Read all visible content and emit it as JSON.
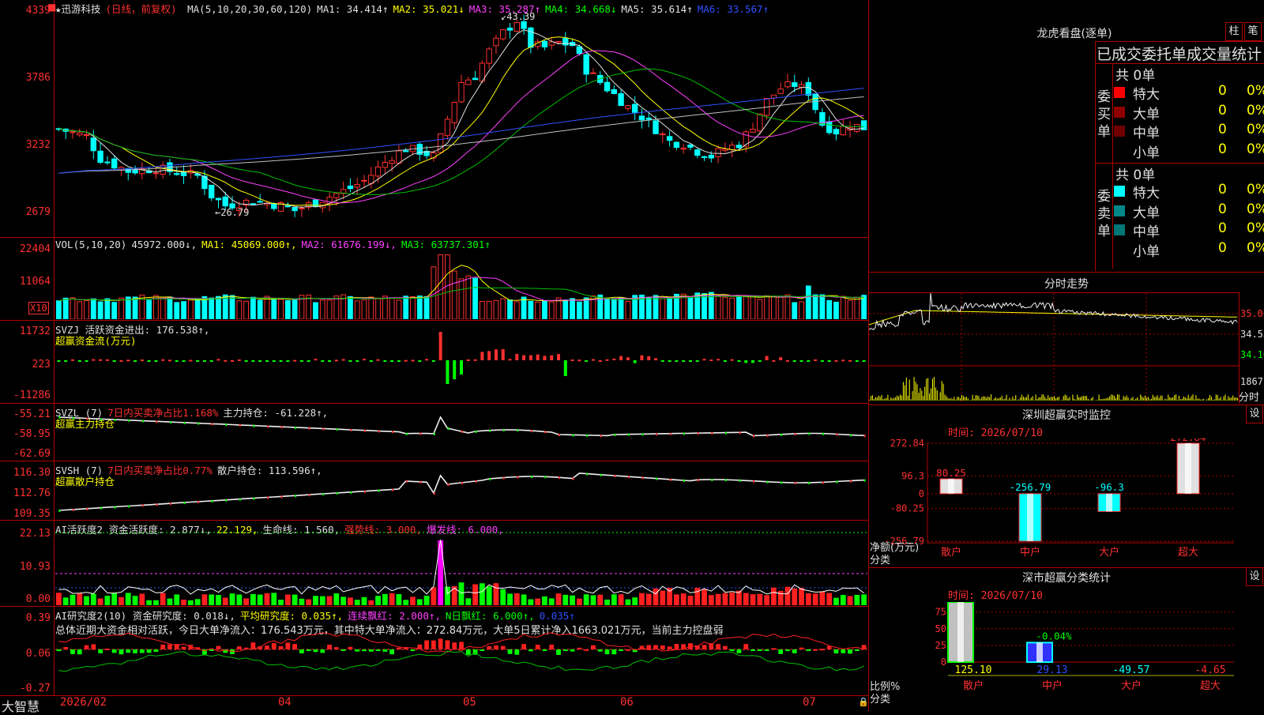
{
  "stock": {
    "name": "★迅游科技",
    "mode": "(日线，前复权)"
  },
  "main_ma": [
    {
      "label": "MA(5,10,20,30,60,120)",
      "cls": "w"
    },
    {
      "label": "MA1: 34.414↑",
      "cls": "w"
    },
    {
      "label": "MA2: 35.021↓",
      "cls": "y"
    },
    {
      "label": "MA3: 35.287↑",
      "cls": "m"
    },
    {
      "label": "MA4: 34.668↓",
      "cls": "g"
    },
    {
      "label": "MA5: 35.614↑",
      "cls": "w"
    },
    {
      "label": "MA6: 33.567↑",
      "cls": "b"
    }
  ],
  "price_axis": [
    "4339",
    "3786",
    "3232",
    "2679"
  ],
  "price_high": "43.39",
  "price_low": "26.79",
  "vol": {
    "axis": [
      "22404",
      "11064",
      "X10"
    ],
    "legend": [
      {
        "label": "VOL(5,10,20)",
        "cls": "w"
      },
      {
        "label": "45972.000↓,",
        "cls": "w"
      },
      {
        "label": "MA1: 45069.000↑,",
        "cls": "y"
      },
      {
        "label": "MA2: 61676.199↓,",
        "cls": "m"
      },
      {
        "label": "MA3: 63737.301↑",
        "cls": "g"
      }
    ]
  },
  "svzj": {
    "axis": [
      "11732",
      "223",
      "-11286"
    ],
    "line1": "SVZJ  活跃资金进出: 176.538↑,",
    "line2": "超赢资金流(万元)"
  },
  "svzl": {
    "axis": [
      "-55.21",
      "-58.95",
      "-62.69"
    ],
    "line1a": "SVZL (7)",
    "line1b": "7日内买卖净占比1.168%",
    "line1c": "主力持仓: -61.228↑,",
    "line2": "超赢主力持仓"
  },
  "svsh": {
    "axis": [
      "116.30",
      "112.76",
      "109.35"
    ],
    "line1a": "SVSH (7)",
    "line1b": "7日内买卖净占比0.77%",
    "line1c": "散户持仓: 113.596↑,",
    "line2": "超赢散户持仓"
  },
  "ai1": {
    "axis": [
      "22.13",
      "10.93",
      "0.00"
    ],
    "legend": [
      {
        "label": "AI活跃度2 资金活跃度: 2.877↓,",
        "cls": "w"
      },
      {
        "label": "22.129,",
        "cls": "y"
      },
      {
        "label": "生命线: 1.560,",
        "cls": "w"
      },
      {
        "label": "强势线: 3.000,",
        "cls": "r"
      },
      {
        "label": "爆发线: 6.000,",
        "cls": "m"
      }
    ]
  },
  "ai2": {
    "axis": [
      "0.39",
      "0.06",
      "-0.27"
    ],
    "legend": [
      {
        "label": "AI研究度2(10) 资金研究度: 0.018↓,",
        "cls": "w"
      },
      {
        "label": "平均研究度: 0.035↑,",
        "cls": "y"
      },
      {
        "label": "连续飘红: 2.000↑,",
        "cls": "m"
      },
      {
        "label": "N日飘红: 6.000↑,",
        "cls": "g"
      },
      {
        "label": "0.035↑",
        "cls": "b"
      }
    ],
    "summary": "总体近期大资金相对活跃，今日大单净流入：176.543万元，其中特大单净流入：272.84万元，大单5日累计净入1663.021万元，当前主力控盘弱"
  },
  "xaxis": {
    "brand": "大智慧",
    "labels": [
      "2026/02",
      "04",
      "05",
      "06",
      "07"
    ]
  },
  "right": {
    "lhkp_title": "龙虎看盘(逐单)",
    "tab_zhu": "柱",
    "tab_bi": "笔",
    "stats_title": "已成交委托单成交量统计",
    "buy": {
      "side": "委买单",
      "total": "共 0单",
      "rows": [
        {
          "name": "特大",
          "v": "0",
          "p": "0%",
          "color": "#ff0000"
        },
        {
          "name": "大单",
          "v": "0",
          "p": "0%",
          "color": "#900000"
        },
        {
          "name": "中单",
          "v": "0",
          "p": "0%",
          "color": "#700000"
        },
        {
          "name": "小单",
          "v": "0",
          "p": "0%",
          "color": ""
        }
      ]
    },
    "sell": {
      "side": "委卖单",
      "total": "共 0单",
      "rows": [
        {
          "name": "特大",
          "v": "0",
          "p": "0%",
          "color": "#00ffff"
        },
        {
          "name": "大单",
          "v": "0",
          "p": "0%",
          "color": "#008888"
        },
        {
          "name": "中单",
          "v": "0",
          "p": "0%",
          "color": "#007777"
        },
        {
          "name": "小单",
          "v": "0",
          "p": "0%",
          "color": ""
        }
      ]
    },
    "fenshi": {
      "title": "分时走势",
      "axis": [
        "35.00",
        "34.55",
        "34.10"
      ],
      "vol_label": "1867",
      "xlabel": "分时"
    },
    "monitor": {
      "title": "深圳超赢实时监控",
      "set": "设",
      "time": "时间: 2026/07/10",
      "axis": [
        "272.84",
        "96.3",
        "0",
        "-80.25",
        "-256.79"
      ],
      "ylabel": "净额(万元)",
      "xlabel": "分类",
      "chart_data": {
        "type": "bar",
        "categories": [
          "散户",
          "中户",
          "大户",
          "超大"
        ],
        "values": [
          80.25,
          -256.79,
          -96.3,
          272.84
        ],
        "value_labels": [
          "80.25",
          "-256.79",
          "-96.3",
          "272.84"
        ],
        "ylim": [
          -256.79,
          272.84
        ]
      }
    },
    "classify": {
      "title": "深市超赢分类统计",
      "set": "设",
      "time": "时间: 2026/07/10",
      "axis": [
        "75",
        "50",
        "25",
        "0"
      ],
      "ylabel": "比例%",
      "xlabel": "分类",
      "chart_data": {
        "type": "bar",
        "categories": [
          "散户",
          "中户",
          "大户",
          "超大"
        ],
        "values": [
          125.1,
          29.13,
          -49.57,
          -4.65
        ],
        "value_labels": [
          "125.10",
          "29.13",
          "-49.57",
          "-4.65"
        ],
        "bar_note": "-0.04%",
        "ylim": [
          0,
          90
        ]
      }
    }
  }
}
